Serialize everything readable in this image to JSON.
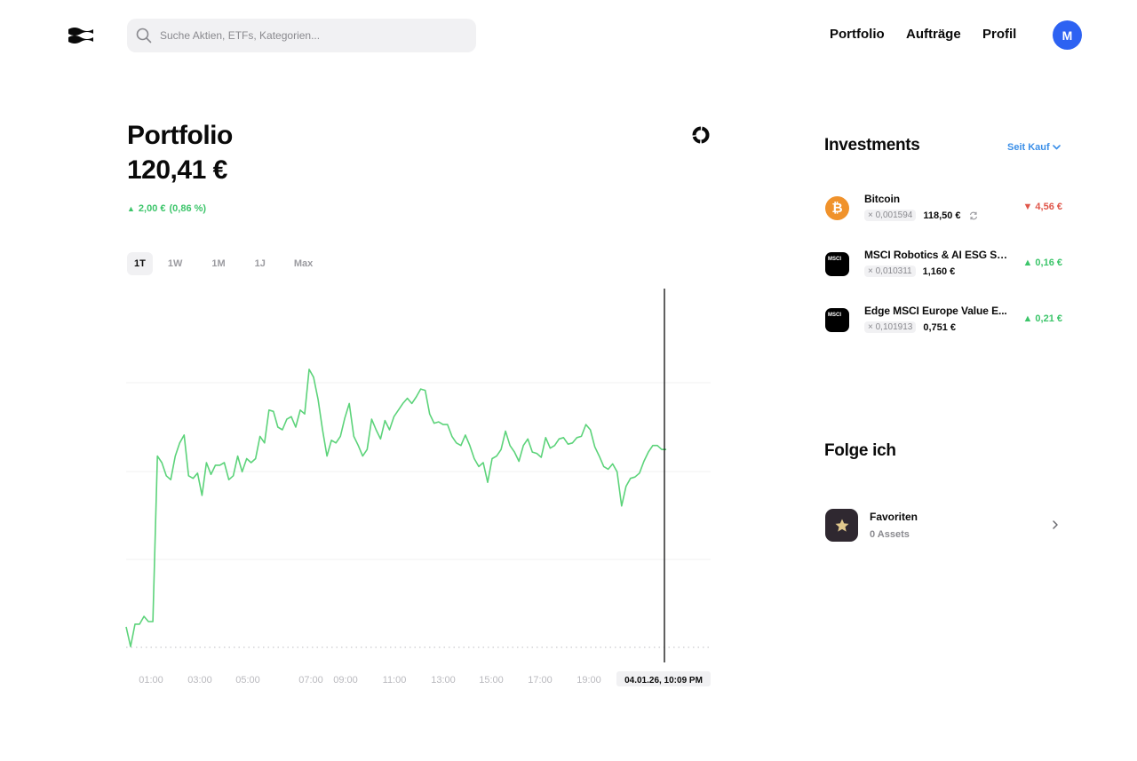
{
  "header": {
    "search_placeholder": "Suche Aktien, ETFs, Kategorien...",
    "nav": [
      "Portfolio",
      "Aufträge",
      "Profil"
    ],
    "avatar_initial": "M",
    "avatar_color": "#2d62f2"
  },
  "portfolio": {
    "title": "Portfolio",
    "value": "120,41 €",
    "change_abs": "2,00 €",
    "change_pct": "(0,86 %)",
    "change_arrow": "▲",
    "ranges": [
      "1T",
      "1W",
      "1M",
      "1J",
      "Max"
    ],
    "active_range": "1T"
  },
  "chart_data": {
    "type": "line",
    "x_tick_labels": [
      "01:00",
      "03:00",
      "05:00",
      "07:00",
      "09:00",
      "11:00",
      "13:00",
      "15:00",
      "17:00",
      "19:00"
    ],
    "cursor_label": "04.01.26, 10:09 PM",
    "line_color": "#5cd37a",
    "grid": true,
    "baseline": "dotted",
    "y_values": [
      118.6,
      118.45,
      118.62,
      118.62,
      118.68,
      118.64,
      118.64,
      119.9,
      119.85,
      119.75,
      119.72,
      119.9,
      120.0,
      120.06,
      119.75,
      119.73,
      119.77,
      119.6,
      119.85,
      119.76,
      119.83,
      119.83,
      119.85,
      119.72,
      119.75,
      119.9,
      119.78,
      119.88,
      119.85,
      119.88,
      120.05,
      120.0,
      120.25,
      120.24,
      120.12,
      120.1,
      120.18,
      120.2,
      120.12,
      120.25,
      120.22,
      120.56,
      120.5,
      120.33,
      120.1,
      119.9,
      120.02,
      120.0,
      120.05,
      120.19,
      120.3,
      120.05,
      119.98,
      119.9,
      119.95,
      120.18,
      120.1,
      120.03,
      120.17,
      120.1,
      120.2,
      120.25,
      120.3,
      120.34,
      120.3,
      120.35,
      120.41,
      120.4,
      120.22,
      120.15,
      120.16,
      120.14,
      120.14,
      120.05,
      120.0,
      119.98,
      120.06,
      119.98,
      119.88,
      119.82,
      119.85,
      119.7,
      119.88,
      119.9,
      119.95,
      120.09,
      119.98,
      119.93,
      119.86,
      119.98,
      120.03,
      119.93,
      119.92,
      119.89,
      120.04,
      119.96,
      119.98,
      120.03,
      120.04,
      119.99,
      120.0,
      120.04,
      120.05,
      120.14,
      120.1,
      119.97,
      119.9,
      119.82,
      119.8,
      119.84,
      119.78,
      119.52,
      119.67,
      119.73,
      119.74,
      119.77,
      119.86,
      119.93,
      119.98,
      119.98,
      119.95,
      119.95
    ],
    "y_range": [
      118.41,
      120.6
    ],
    "baseline_value": 118.41
  },
  "investments": {
    "title": "Investments",
    "filter_label": "Seit Kauf",
    "items": [
      {
        "name": "Bitcoin",
        "qty": "× 0,001594",
        "price": "118,50 €",
        "change": "4,56 €",
        "arrow": "▼",
        "direction": "down",
        "icon": "bitcoin-icon",
        "icon_text": "₿",
        "has_sync": true
      },
      {
        "name": "MSCI Robotics & AI ESG Sc...",
        "qty": "× 0,010311",
        "price": "1,160 €",
        "change": "0,16 €",
        "arrow": "▲",
        "direction": "up",
        "icon": "msci-logo",
        "icon_text": "MSCI",
        "has_sync": false
      },
      {
        "name": "Edge MSCI Europe Value E...",
        "qty": "× 0,101913",
        "price": "0,751 €",
        "change": "0,21 €",
        "arrow": "▲",
        "direction": "up",
        "icon": "msci-logo",
        "icon_text": "MSCI",
        "has_sync": false
      }
    ]
  },
  "following": {
    "title": "Folge ich",
    "items": [
      {
        "name": "Favoriten",
        "sub": "0 Assets",
        "icon": "star-icon"
      }
    ]
  }
}
